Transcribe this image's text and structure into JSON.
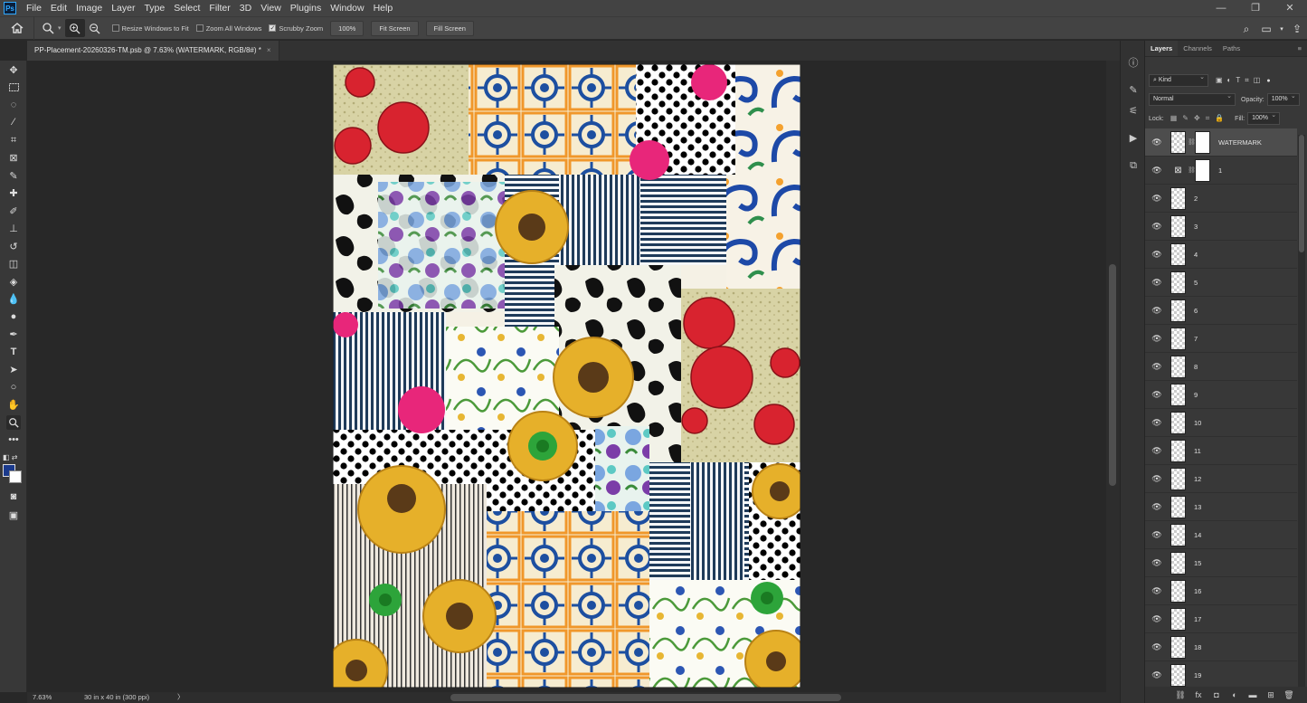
{
  "menu": {
    "logo": "Ps",
    "items": [
      "File",
      "Edit",
      "Image",
      "Layer",
      "Type",
      "Select",
      "Filter",
      "3D",
      "View",
      "Plugins",
      "Window",
      "Help"
    ],
    "window_controls": [
      "minimize-icon",
      "restore-icon",
      "close-icon"
    ]
  },
  "options": {
    "resize_windows": "Resize Windows to Fit",
    "zoom_all": "Zoom All Windows",
    "scrubby": "Scrubby Zoom",
    "zoom_value": "100%",
    "fit_screen": "Fit Screen",
    "fill_screen": "Fill Screen"
  },
  "document": {
    "tab_title": "PP-Placement-20260326-TM.psb @ 7.63% (WATERMARK, RGB/8#) *",
    "close": "×"
  },
  "status": {
    "zoom": "7.63%",
    "info": "30 in x 40 in (300 ppi)",
    "arrow": "〉"
  },
  "colors": {
    "foreground": "#1b3a8c",
    "background": "#ffffff",
    "accent": "#31a8ff"
  },
  "layers_panel": {
    "tabs": [
      "Layers",
      "Channels",
      "Paths"
    ],
    "filter": "Kind",
    "blend_mode": "Normal",
    "opacity_label": "Opacity:",
    "opacity": "100%",
    "lock_label": "Lock:",
    "fill_label": "Fill:",
    "fill": "100%",
    "layers": [
      "WATERMARK",
      "1",
      "2",
      "3",
      "4",
      "5",
      "6",
      "7",
      "8",
      "9",
      "10",
      "11",
      "12",
      "13",
      "14",
      "15",
      "16",
      "17",
      "18",
      "19"
    ],
    "selected": "WATERMARK"
  }
}
